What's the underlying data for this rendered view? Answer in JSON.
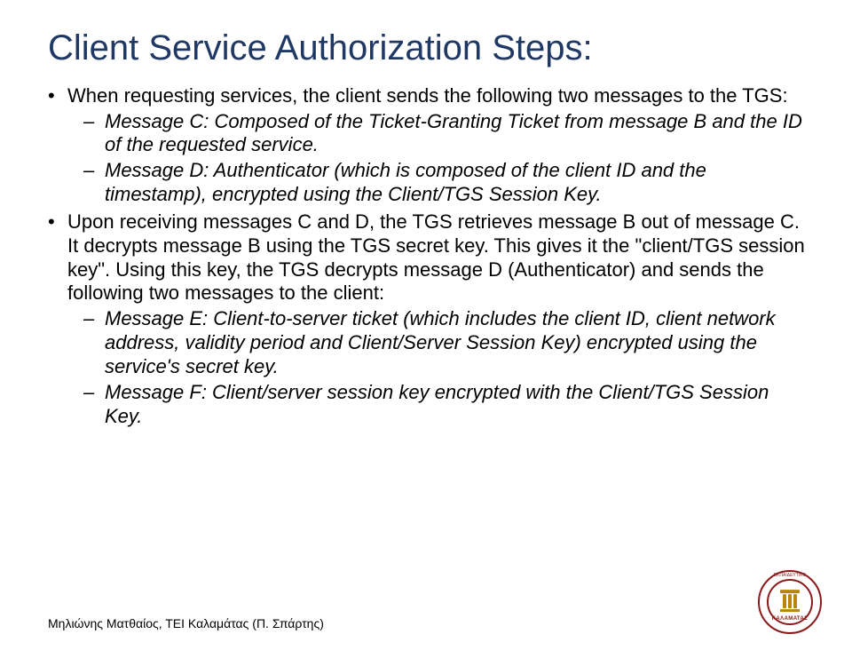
{
  "title": "Client Service Authorization Steps:",
  "bullets": {
    "b0": {
      "text": "When requesting services, the client sends the following two messages to the TGS:",
      "sub": {
        "s0": "Message C: Composed of the Ticket-Granting Ticket from message B and the ID of the requested service.",
        "s1": "Message D: Authenticator (which is composed of the client ID and the timestamp), encrypted using the Client/TGS Session Key."
      }
    },
    "b1": {
      "text": "Upon receiving messages C and D, the TGS retrieves message B out of message C. It decrypts message B using the TGS secret key. This gives it the \"client/TGS session key\". Using this key, the TGS decrypts message D (Authenticator) and sends the following two messages to the client:",
      "sub": {
        "s0": "Message E: Client-to-server ticket (which includes the client ID, client network address, validity period and Client/Server Session Key) encrypted using the service's secret key.",
        "s1": "Message F: Client/server session key encrypted with the Client/TGS Session Key."
      }
    }
  },
  "footer": "Μηλιώνης Ματθαίος, ΤΕΙ Καλαμάτας (Π. Σπάρτης)",
  "seal": {
    "label": "ΚΑΛΑΜΑΤΑΣ",
    "top": "ΕΚΠΑΙΔΕΥΤΙΚΟ"
  }
}
